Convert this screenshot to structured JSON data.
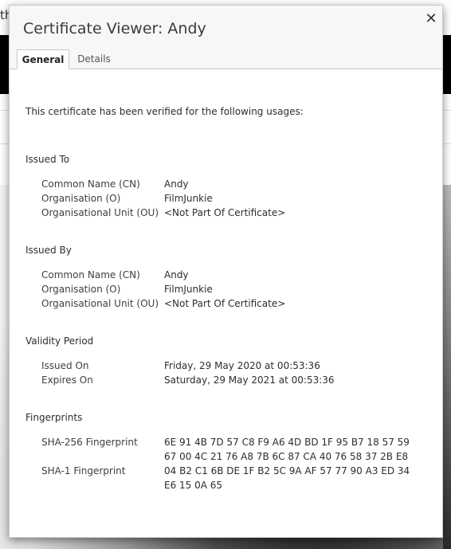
{
  "background": {
    "text_fragment": "th"
  },
  "dialog": {
    "title": "Certificate Viewer: Andy",
    "close_symbol": "✕",
    "tabs": [
      "General",
      "Details"
    ]
  },
  "general": {
    "intro": "This certificate has been verified for the following usages:",
    "issued_to": {
      "heading": "Issued To",
      "rows": [
        {
          "label": "Common Name (CN)",
          "value": "Andy"
        },
        {
          "label": "Organisation (O)",
          "value": "FilmJunkie"
        },
        {
          "label": "Organisational Unit (OU)",
          "value": "<Not Part Of Certificate>"
        }
      ]
    },
    "issued_by": {
      "heading": "Issued By",
      "rows": [
        {
          "label": "Common Name (CN)",
          "value": "Andy"
        },
        {
          "label": "Organisation (O)",
          "value": "FilmJunkie"
        },
        {
          "label": "Organisational Unit (OU)",
          "value": "<Not Part Of Certificate>"
        }
      ]
    },
    "validity": {
      "heading": "Validity Period",
      "rows": [
        {
          "label": "Issued On",
          "value": "Friday, 29 May 2020 at 00:53:36"
        },
        {
          "label": "Expires On",
          "value": "Saturday, 29 May 2021 at 00:53:36"
        }
      ]
    },
    "fingerprints": {
      "heading": "Fingerprints",
      "sha256": {
        "label": "SHA-256 Fingerprint",
        "line1": "6E 91 4B 7D 57 C8 F9 A6 4D BD 1F 95 B7 18 57 59",
        "line2": "67 00 4C 21 76 A8 7B 6C 87 CA 40 76 58 37 2B E8"
      },
      "sha1": {
        "label": "SHA-1 Fingerprint",
        "line1": "04 B2 C1 6B DE 1F B2 5C 9A AF 57 77 90 A3 ED 34",
        "line2": "E6 15 0A 65"
      }
    }
  }
}
